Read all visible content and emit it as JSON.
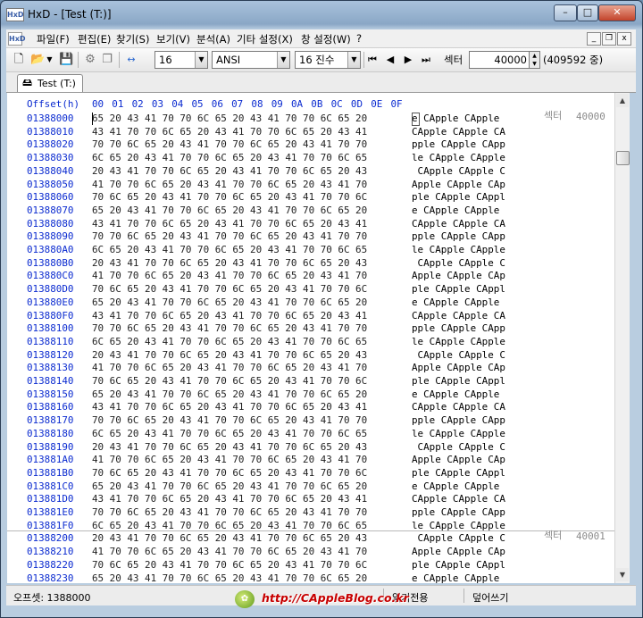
{
  "window": {
    "title": "HxD - [Test (T:)]",
    "app_icon": "HxD"
  },
  "caption_buttons": {
    "minimize": "–",
    "maximize": "□",
    "close": "✕"
  },
  "menu": {
    "items": [
      "파일(F)",
      "편집(E)",
      "찾기(S)",
      "보기(V)",
      "분석(A)",
      "기타 설정(X)",
      "창 설정(W)",
      "?"
    ],
    "mdi": {
      "minimize": "_",
      "restore": "❐",
      "close": "x"
    }
  },
  "toolbar": {
    "bytes_per_row": "16",
    "charset": "ANSI",
    "offset_base": "16 진수",
    "sector_label": "섹터",
    "sector_value": "40000",
    "sector_total": "(409592 중)",
    "icons": [
      "new-file-icon",
      "open-file-icon",
      "dropdown-arrow-icon",
      "save-icon",
      "gears-icon",
      "copy-icon",
      "columns-icon",
      "first-sector-icon",
      "prev-sector-icon",
      "next-sector-icon",
      "last-sector-icon"
    ]
  },
  "tabs": [
    {
      "label": "Test (T:)",
      "icon": "drive-icon"
    }
  ],
  "editor": {
    "header": {
      "offset_label": "Offset(h)",
      "columns": [
        "00",
        "01",
        "02",
        "03",
        "04",
        "05",
        "06",
        "07",
        "08",
        "09",
        "0A",
        "0B",
        "0C",
        "0D",
        "0E",
        "0F"
      ]
    },
    "rows": [
      {
        "offset": "01388000",
        "hex": "65 20 43 41 70 70 6C 65 20 43 41 70 70 6C 65 20",
        "ascii": "e CApple CApple "
      },
      {
        "offset": "01388010",
        "hex": "43 41 70 70 6C 65 20 43 41 70 70 6C 65 20 43 41",
        "ascii": "CApple CApple CA"
      },
      {
        "offset": "01388020",
        "hex": "70 70 6C 65 20 43 41 70 70 6C 65 20 43 41 70 70",
        "ascii": "pple CApple CApp"
      },
      {
        "offset": "01388030",
        "hex": "6C 65 20 43 41 70 70 6C 65 20 43 41 70 70 6C 65",
        "ascii": "le CApple CApple"
      },
      {
        "offset": "01388040",
        "hex": "20 43 41 70 70 6C 65 20 43 41 70 70 6C 65 20 43",
        "ascii": " CApple CApple C"
      },
      {
        "offset": "01388050",
        "hex": "41 70 70 6C 65 20 43 41 70 70 6C 65 20 43 41 70",
        "ascii": "Apple CApple CAp"
      },
      {
        "offset": "01388060",
        "hex": "70 6C 65 20 43 41 70 70 6C 65 20 43 41 70 70 6C",
        "ascii": "ple CApple CAppl"
      },
      {
        "offset": "01388070",
        "hex": "65 20 43 41 70 70 6C 65 20 43 41 70 70 6C 65 20",
        "ascii": "e CApple CApple "
      },
      {
        "offset": "01388080",
        "hex": "43 41 70 70 6C 65 20 43 41 70 70 6C 65 20 43 41",
        "ascii": "CApple CApple CA"
      },
      {
        "offset": "01388090",
        "hex": "70 70 6C 65 20 43 41 70 70 6C 65 20 43 41 70 70",
        "ascii": "pple CApple CApp"
      },
      {
        "offset": "013880A0",
        "hex": "6C 65 20 43 41 70 70 6C 65 20 43 41 70 70 6C 65",
        "ascii": "le CApple CApple"
      },
      {
        "offset": "013880B0",
        "hex": "20 43 41 70 70 6C 65 20 43 41 70 70 6C 65 20 43",
        "ascii": " CApple CApple C"
      },
      {
        "offset": "013880C0",
        "hex": "41 70 70 6C 65 20 43 41 70 70 6C 65 20 43 41 70",
        "ascii": "Apple CApple CAp"
      },
      {
        "offset": "013880D0",
        "hex": "70 6C 65 20 43 41 70 70 6C 65 20 43 41 70 70 6C",
        "ascii": "ple CApple CAppl"
      },
      {
        "offset": "013880E0",
        "hex": "65 20 43 41 70 70 6C 65 20 43 41 70 70 6C 65 20",
        "ascii": "e CApple CApple "
      },
      {
        "offset": "013880F0",
        "hex": "43 41 70 70 6C 65 20 43 41 70 70 6C 65 20 43 41",
        "ascii": "CApple CApple CA"
      },
      {
        "offset": "01388100",
        "hex": "70 70 6C 65 20 43 41 70 70 6C 65 20 43 41 70 70",
        "ascii": "pple CApple CApp"
      },
      {
        "offset": "01388110",
        "hex": "6C 65 20 43 41 70 70 6C 65 20 43 41 70 70 6C 65",
        "ascii": "le CApple CApple"
      },
      {
        "offset": "01388120",
        "hex": "20 43 41 70 70 6C 65 20 43 41 70 70 6C 65 20 43",
        "ascii": " CApple CApple C"
      },
      {
        "offset": "01388130",
        "hex": "41 70 70 6C 65 20 43 41 70 70 6C 65 20 43 41 70",
        "ascii": "Apple CApple CAp"
      },
      {
        "offset": "01388140",
        "hex": "70 6C 65 20 43 41 70 70 6C 65 20 43 41 70 70 6C",
        "ascii": "ple CApple CAppl"
      },
      {
        "offset": "01388150",
        "hex": "65 20 43 41 70 70 6C 65 20 43 41 70 70 6C 65 20",
        "ascii": "e CApple CApple "
      },
      {
        "offset": "01388160",
        "hex": "43 41 70 70 6C 65 20 43 41 70 70 6C 65 20 43 41",
        "ascii": "CApple CApple CA"
      },
      {
        "offset": "01388170",
        "hex": "70 70 6C 65 20 43 41 70 70 6C 65 20 43 41 70 70",
        "ascii": "pple CApple CApp"
      },
      {
        "offset": "01388180",
        "hex": "6C 65 20 43 41 70 70 6C 65 20 43 41 70 70 6C 65",
        "ascii": "le CApple CApple"
      },
      {
        "offset": "01388190",
        "hex": "20 43 41 70 70 6C 65 20 43 41 70 70 6C 65 20 43",
        "ascii": " CApple CApple C"
      },
      {
        "offset": "013881A0",
        "hex": "41 70 70 6C 65 20 43 41 70 70 6C 65 20 43 41 70",
        "ascii": "Apple CApple CAp"
      },
      {
        "offset": "013881B0",
        "hex": "70 6C 65 20 43 41 70 70 6C 65 20 43 41 70 70 6C",
        "ascii": "ple CApple CAppl"
      },
      {
        "offset": "013881C0",
        "hex": "65 20 43 41 70 70 6C 65 20 43 41 70 70 6C 65 20",
        "ascii": "e CApple CApple "
      },
      {
        "offset": "013881D0",
        "hex": "43 41 70 70 6C 65 20 43 41 70 70 6C 65 20 43 41",
        "ascii": "CApple CApple CA"
      },
      {
        "offset": "013881E0",
        "hex": "70 70 6C 65 20 43 41 70 70 6C 65 20 43 41 70 70",
        "ascii": "pple CApple CApp"
      },
      {
        "offset": "013881F0",
        "hex": "6C 65 20 43 41 70 70 6C 65 20 43 41 70 70 6C 65",
        "ascii": "le CApple CApple"
      },
      {
        "offset": "01388200",
        "hex": "20 43 41 70 70 6C 65 20 43 41 70 70 6C 65 20 43",
        "ascii": " CApple CApple C"
      },
      {
        "offset": "01388210",
        "hex": "41 70 70 6C 65 20 43 41 70 70 6C 65 20 43 41 70",
        "ascii": "Apple CApple CAp"
      },
      {
        "offset": "01388220",
        "hex": "70 6C 65 20 43 41 70 70 6C 65 20 43 41 70 70 6C",
        "ascii": "ple CApple CAppl"
      },
      {
        "offset": "01388230",
        "hex": "65 20 43 41 70 70 6C 65 20 43 41 70 70 6C 65 20",
        "ascii": "e CApple CApple "
      }
    ],
    "sector_markers": [
      {
        "label": "섹터",
        "value": "40000",
        "row": 0
      },
      {
        "label": "섹터",
        "value": "40001",
        "row": 32
      }
    ]
  },
  "statusbar": {
    "offset": "오프셋: 1388000",
    "mode": "읽기전용",
    "insert_mode": "덮어쓰기"
  },
  "watermark": {
    "text": "http://CAppleBlog.co.kr"
  },
  "colors": {
    "offset_blue": "#0b2bd0",
    "sector_gray": "#8a8a8a",
    "watermark_red": "#c70000"
  }
}
